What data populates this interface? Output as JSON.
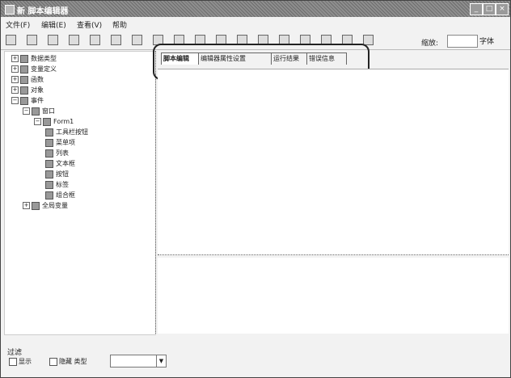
{
  "window": {
    "title": "新 脚本编辑器",
    "buttons": [
      "_",
      "□",
      "×"
    ]
  },
  "menu": [
    "文件(F)",
    "编辑(E)",
    "查看(V)",
    "帮助"
  ],
  "toolbar": {
    "icons": [
      "new-icon",
      "open-icon",
      "save-icon",
      "cut-icon",
      "copy-icon",
      "paste-icon",
      "undo-icon",
      "redo-icon",
      "find-icon",
      "replace-icon",
      "run-icon",
      "stop-icon",
      "debug-icon",
      "step-icon",
      "watch-icon",
      "bookmark-icon",
      "options-icon",
      "help-icon"
    ],
    "zoom_label": "缩放:",
    "zoom_value": "",
    "extra": "字体"
  },
  "tree": [
    {
      "label": "数据类型",
      "indent": 0,
      "expanded": false
    },
    {
      "label": "变量定义",
      "indent": 0,
      "expanded": false
    },
    {
      "label": "函数",
      "indent": 0,
      "expanded": false
    },
    {
      "label": "对象",
      "indent": 0,
      "expanded": false
    },
    {
      "label": "事件",
      "indent": 0,
      "expanded": true
    },
    {
      "label": "窗口",
      "indent": 1,
      "expanded": true
    },
    {
      "label": "Form1",
      "indent": 2,
      "expanded": true
    },
    {
      "label": "工具栏按钮",
      "indent": 3,
      "expanded": null
    },
    {
      "label": "菜单项",
      "indent": 3,
      "expanded": null
    },
    {
      "label": "列表",
      "indent": 3,
      "expanded": null
    },
    {
      "label": "文本框",
      "indent": 3,
      "expanded": null
    },
    {
      "label": "按钮",
      "indent": 3,
      "expanded": null
    },
    {
      "label": "标签",
      "indent": 3,
      "expanded": null
    },
    {
      "label": "组合框",
      "indent": 3,
      "expanded": null
    },
    {
      "label": "全局变量",
      "indent": 1,
      "expanded": false
    }
  ],
  "tabs": [
    {
      "label": "脚本编辑",
      "active": true
    },
    {
      "label": "编辑器属性设置",
      "active": false
    },
    {
      "label": "运行结果",
      "active": false
    },
    {
      "label": "错误信息",
      "active": false
    }
  ],
  "bottom": {
    "label": "过滤",
    "option1": "显示",
    "option2": "隐藏 类型",
    "select_value": ""
  }
}
